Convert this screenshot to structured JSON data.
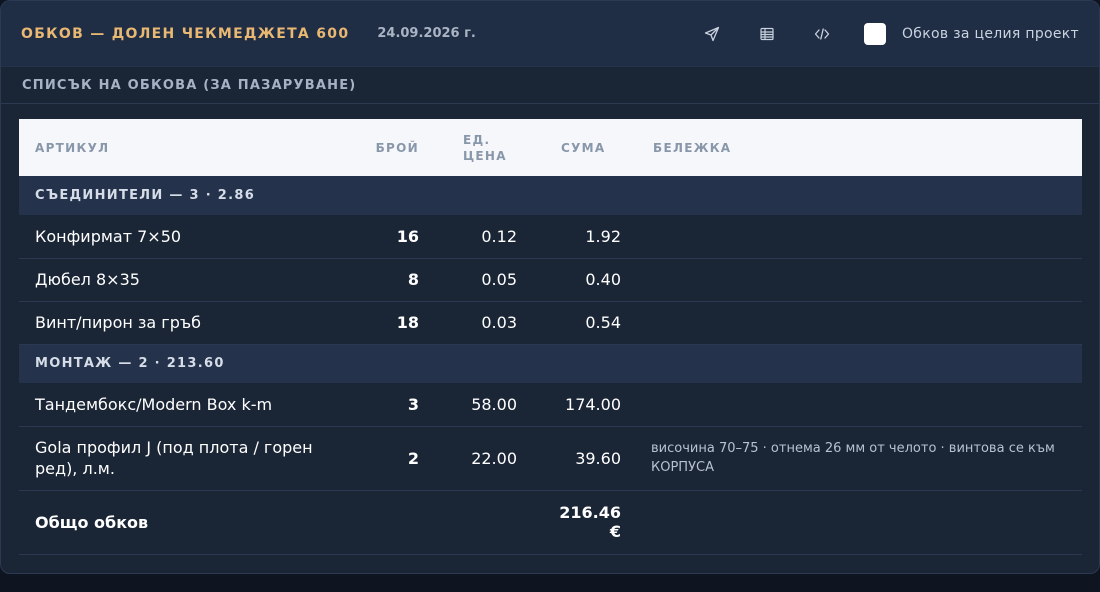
{
  "header": {
    "title": "ОБКОВ — ДОЛЕН ЧЕКМЕДЖЕТА 600",
    "date": "24.09.2026 г.",
    "tools": [
      {
        "icon": "send-icon"
      },
      {
        "icon": "table-icon"
      },
      {
        "icon": "code-icon"
      }
    ],
    "checkbox_label": "Обков за целия проект",
    "checkbox_checked": false
  },
  "section": {
    "title": "СПИСЪК НА ОБКОВА (ЗА ПАЗАРУВАНЕ)"
  },
  "table": {
    "columns": [
      "АРТИКУЛ",
      "БРОЙ",
      "ЕД.\nЦЕНА",
      "СУМА",
      "БЕЛЕЖКА"
    ],
    "groups": [
      {
        "label": "СЪЕДИНИТЕЛИ — 3 · 2.86",
        "rows": [
          {
            "article": "Конфирмат 7×50",
            "qty": "16",
            "unit_price": "0.12",
            "sum": "1.92",
            "note": ""
          },
          {
            "article": "Дюбел 8×35",
            "qty": "8",
            "unit_price": "0.05",
            "sum": "0.40",
            "note": ""
          },
          {
            "article": "Винт/пирон за гръб",
            "qty": "18",
            "unit_price": "0.03",
            "sum": "0.54",
            "note": ""
          }
        ]
      },
      {
        "label": "МОНТАЖ — 2 · 213.60",
        "rows": [
          {
            "article": "Тандембокс/Modern Box k-m",
            "qty": "3",
            "unit_price": "58.00",
            "sum": "174.00",
            "note": ""
          },
          {
            "article": "Gola профил J (под плота / горен ред), л.м.",
            "qty": "2",
            "unit_price": "22.00",
            "sum": "39.60",
            "note": "височина 70–75 · отнема 26 мм от челото · винтова се към КОРПУСА"
          }
        ]
      }
    ],
    "total": {
      "label": "Общо обков",
      "sum": "216.46",
      "currency": "€"
    }
  }
}
